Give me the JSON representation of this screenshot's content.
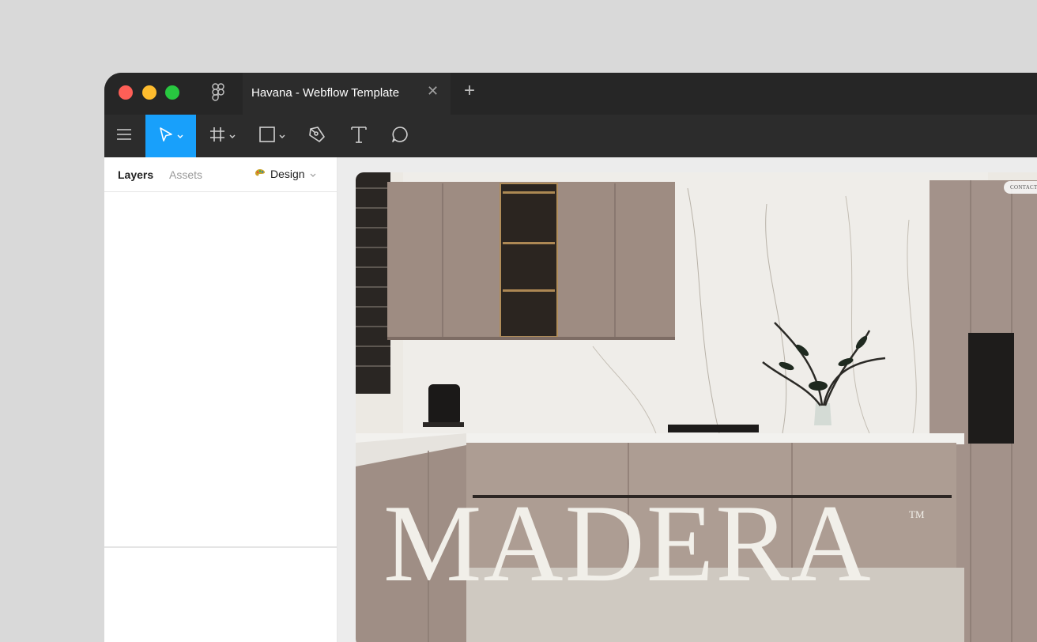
{
  "window": {
    "tab_title": "Havana - Webflow Template",
    "close_tab": "✕",
    "new_tab": "+"
  },
  "toolbar": {
    "tools": [
      "menu-icon",
      "move-icon",
      "frame-icon",
      "rectangle-icon",
      "pen-icon",
      "text-icon",
      "comment-icon"
    ],
    "accent": "#18a0fb"
  },
  "sidebar": {
    "tab_layers": "Layers",
    "tab_assets": "Assets",
    "tab_design": "Design"
  },
  "canvas": {
    "contact_label": "CONTACT",
    "hero_title": "MADERA",
    "hero_tm": "TM"
  }
}
